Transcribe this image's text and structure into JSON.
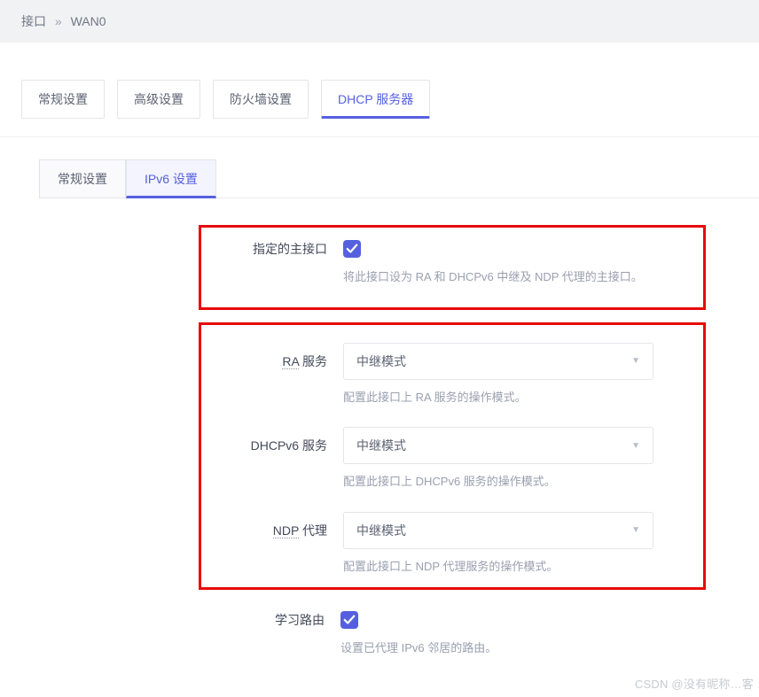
{
  "breadcrumb": {
    "part1": "接口",
    "sep": "»",
    "part2": "WAN0"
  },
  "tabs_outer": {
    "general": "常规设置",
    "advanced": "高级设置",
    "firewall": "防火墙设置",
    "dhcp": "DHCP 服务器"
  },
  "tabs_inner": {
    "general": "常规设置",
    "ipv6": "IPv6 设置"
  },
  "labels": {
    "master": "指定的主接口",
    "ra_prefix": "RA",
    "ra_suffix": " 服务",
    "dhcpv6": "DHCPv6 服务",
    "ndp_prefix": "NDP",
    "ndp_suffix": " 代理",
    "learn": "学习路由"
  },
  "selects": {
    "ra": "中继模式",
    "dhcpv6": "中继模式",
    "ndp": "中继模式"
  },
  "hints": {
    "master": "将此接口设为 RA 和 DHCPv6 中继及 NDP 代理的主接口。",
    "ra": "配置此接口上 RA 服务的操作模式。",
    "dhcpv6": "配置此接口上 DHCPv6 服务的操作模式。",
    "ndp": "配置此接口上 NDP 代理服务的操作模式。",
    "learn": "设置已代理 IPv6 邻居的路由。"
  },
  "watermark": "CSDN @没有昵称…客"
}
